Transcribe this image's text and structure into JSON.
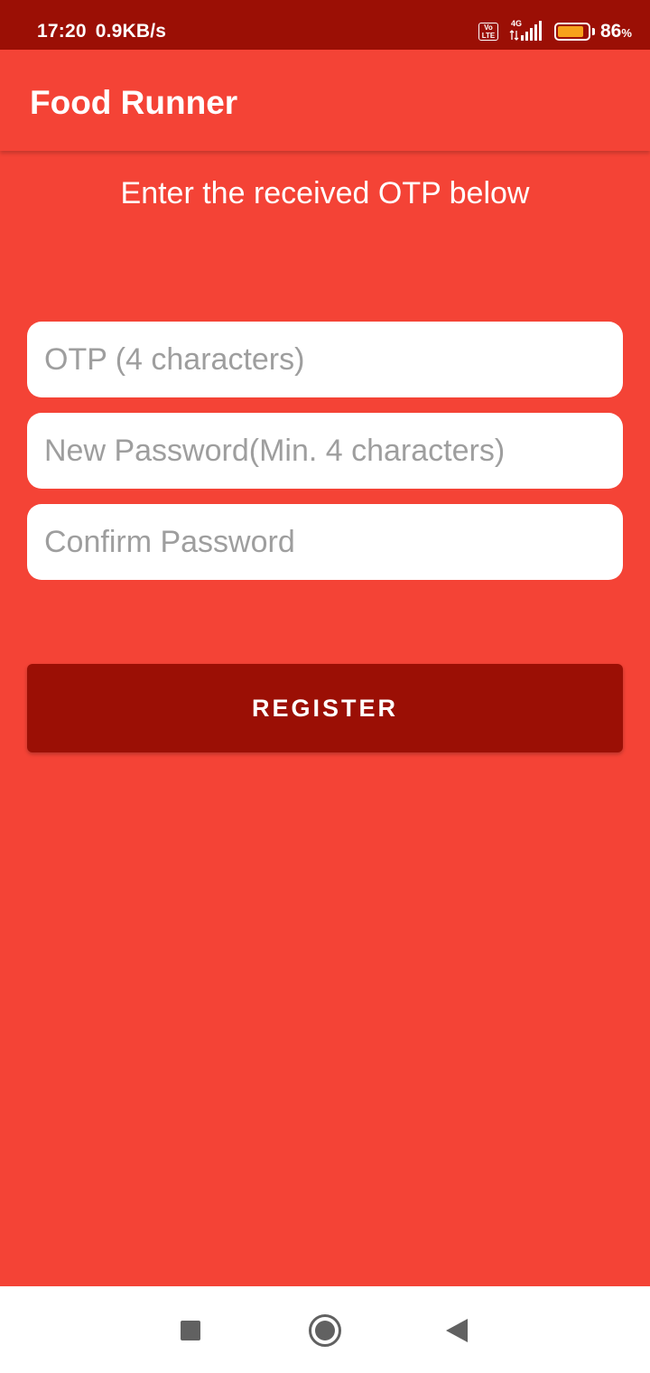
{
  "status_bar": {
    "time": "17:20",
    "network_speed": "0.9KB/s",
    "volte_label": "Vo\nLTE",
    "network_type": "4G",
    "battery_level": 0.86,
    "battery_percent": "86",
    "battery_symbol": "%",
    "icons": [
      "volte-icon",
      "signal-icon",
      "battery-icon"
    ]
  },
  "app_bar": {
    "title": "Food Runner"
  },
  "content": {
    "instruction": "Enter the received OTP below",
    "otp_placeholder": "OTP (4 characters)",
    "new_password_placeholder": "New Password(Min. 4 characters)",
    "confirm_password_placeholder": "Confirm Password",
    "register_label": "REGISTER"
  },
  "nav_bar": {
    "icons": [
      "recents-icon",
      "home-icon",
      "back-icon"
    ]
  },
  "colors": {
    "primary": "#F44336",
    "primary_dark": "#9B0F05",
    "placeholder": "#9E9E9E",
    "battery_fill": "#F7A21B"
  }
}
